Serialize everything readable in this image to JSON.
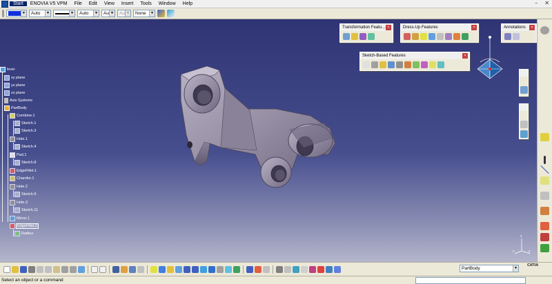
{
  "menu": {
    "items": [
      "Start",
      "ENOVIA V5 VPM",
      "File",
      "Edit",
      "View",
      "Insert",
      "Tools",
      "Window",
      "Help"
    ]
  },
  "properties_bar": {
    "fill_color": "#1030e0",
    "transparency": "Auto",
    "line_thickness": "Auto",
    "line_type": "Aut",
    "point_symbol": "Aut",
    "layer": "None"
  },
  "tree": {
    "root": "lever",
    "planes": [
      "xy plane",
      "yz plane",
      "zx plane"
    ],
    "axis_systems": "Axis Systems",
    "part_body": "PartBody",
    "features": [
      {
        "label": "Combine.1",
        "children": [
          "Sketch.1",
          "Sketch.3"
        ]
      },
      {
        "label": "Hole.1",
        "children": [
          "Sketch.4"
        ]
      },
      {
        "label": "Pad.1",
        "children": [
          "Sketch.8"
        ]
      },
      {
        "label": "EdgeFillet.1",
        "children": []
      },
      {
        "label": "Chamfer.1",
        "children": []
      },
      {
        "label": "Hole.2",
        "children": [
          "Sketch.9"
        ]
      },
      {
        "label": "Hole.3",
        "children": [
          "Sketch.11"
        ]
      },
      {
        "label": "Mirror.1",
        "children": []
      },
      {
        "label": "EdgeFillet.2",
        "children": [
          "Radius"
        ]
      }
    ]
  },
  "toolbars": {
    "transformation": "Transformation Featu...",
    "dress_up": "Dress-Up Features",
    "annotations": "Annotations",
    "sketch_based": "Sketch-Based Features",
    "close_label": "×"
  },
  "bottom": {
    "current_body": "PartBody",
    "scale_label": "10.1 10.0"
  },
  "status": {
    "message": "Select an object or a command"
  },
  "axis": {
    "x": "x",
    "y": "y",
    "z": "z"
  },
  "logo": "CATIA",
  "colors": {
    "viewport_top": "#2f3474",
    "viewport_bottom": "#b4b6cc",
    "part": "#9a94a6",
    "close": "#c84040"
  }
}
